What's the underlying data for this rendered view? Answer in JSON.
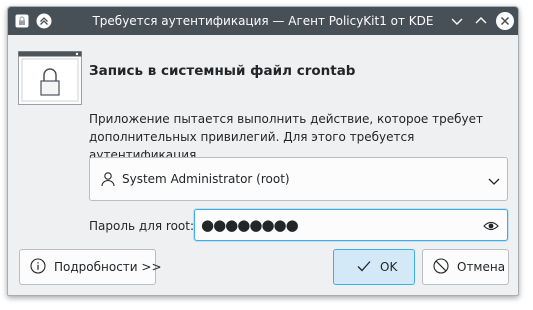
{
  "window": {
    "title": "Требуется аутентификация — Агент PolicyKit1 от KDE",
    "icons": [
      "lock-icon",
      "keep-above-icon",
      "minimize-icon",
      "maximize-icon",
      "close-icon"
    ]
  },
  "header": {
    "icon": "lock-window-icon",
    "title": "Запись в системный файл crontab"
  },
  "message": "Приложение пытается выполнить действие, которое требует дополнительных привилегий. Для этого требуется аутентификация.",
  "identity": {
    "icon": "user-icon",
    "selected": "System Administrator (root)"
  },
  "password": {
    "label": "Пароль для root:",
    "value": "●●●●●●●●",
    "reveal_icon": "eye-icon"
  },
  "buttons": {
    "details": "Подробности >>",
    "ok": "OK",
    "cancel": "Отмена"
  },
  "colors": {
    "titlebar": "#475057",
    "accent": "#3daee9",
    "background": "#eff0f1"
  }
}
